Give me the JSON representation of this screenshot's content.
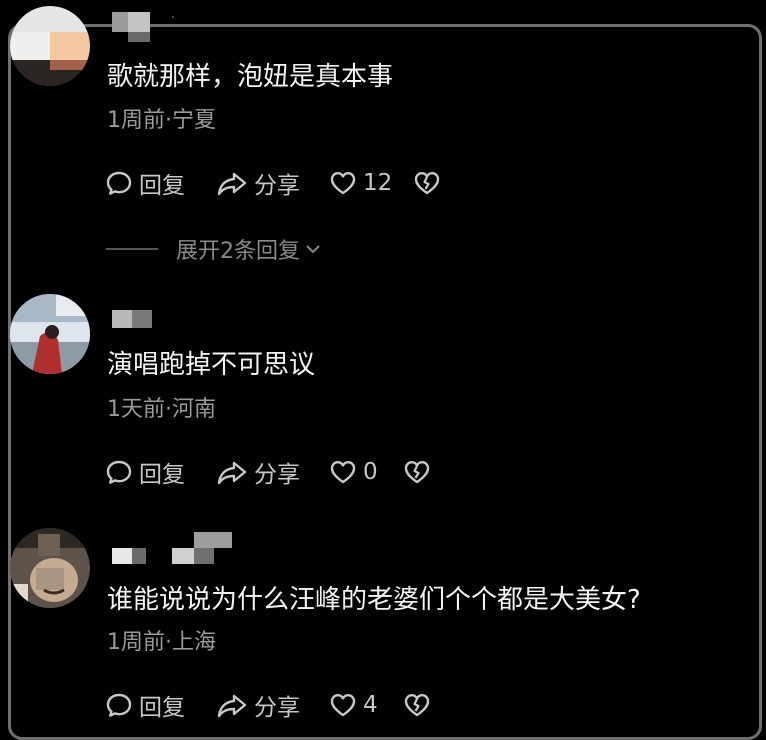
{
  "comments": [
    {
      "text": "歌就那样，泡妞是真本事",
      "meta": "1周前·宁夏",
      "reply_label": "回复",
      "share_label": "分享",
      "like_count": "12",
      "avatar_colors": {
        "top": "#6b5e5a",
        "mid": "#d7a074",
        "bottom": "#2a2222"
      }
    },
    {
      "text": "演唱跑掉不可思议",
      "meta": "1天前·河南",
      "reply_label": "回复",
      "share_label": "分享",
      "like_count": "0",
      "avatar_colors": {
        "top": "#9fb0c2",
        "mid": "#d6dde8",
        "bottom": "#b23a3a"
      }
    },
    {
      "text": "谁能说说为什么汪峰的老婆们个个都是大美女?",
      "meta": "1周前·上海",
      "reply_label": "回复",
      "share_label": "分享",
      "like_count": "4",
      "avatar_colors": {
        "top": "#3b3630",
        "mid": "#8a7b6a",
        "bottom": "#c9b8a4"
      }
    }
  ],
  "expand_replies": {
    "label": "展开2条回复"
  },
  "icons": {
    "reply": "comment-bubble-icon",
    "share": "share-arrow-icon",
    "like": "heart-icon",
    "dislike": "broken-heart-icon",
    "expand": "chevron-down-icon"
  },
  "colors": {
    "background": "#000000",
    "frame_border": "#6f6f6f",
    "primary_text": "#f4f4f4",
    "secondary_text": "#9a9a9a",
    "action_text": "#c8c8c8"
  }
}
